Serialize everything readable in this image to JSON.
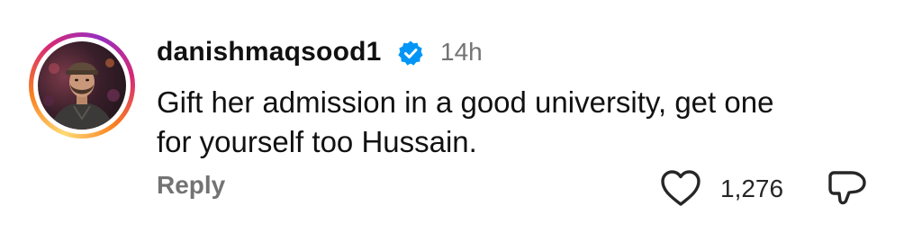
{
  "comment": {
    "username": "danishmaqsood1",
    "verified": true,
    "time": "14h",
    "text_lines": [
      "Gift her admission in a good university, get one",
      "for yourself too Hussain."
    ],
    "reply_label": "Reply",
    "like_count": "1,276",
    "icons": {
      "verified": "verified-badge-icon",
      "like": "heart-icon",
      "dislike": "thumbs-down-icon"
    }
  },
  "colors": {
    "verified_blue": "#0095f6",
    "muted_text": "#737373",
    "primary_text": "#111111"
  }
}
